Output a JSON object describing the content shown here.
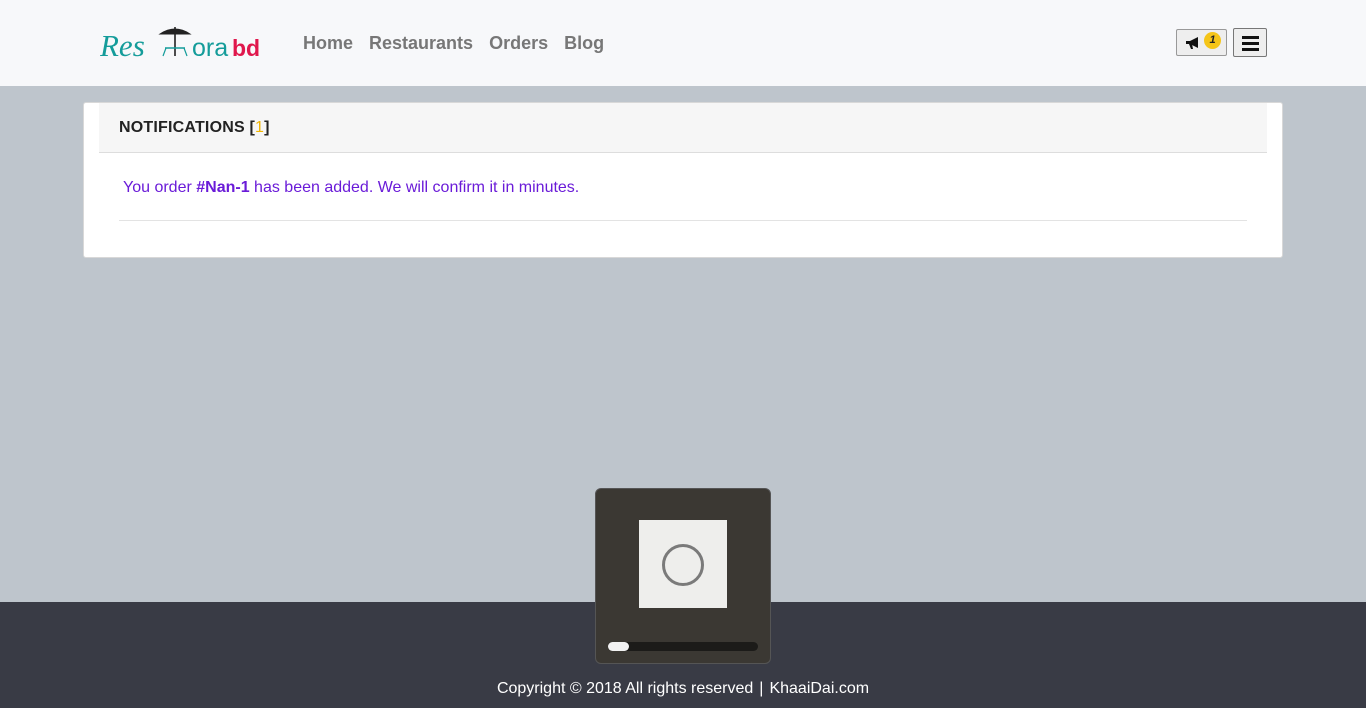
{
  "brand": {
    "logo_part1": "Res",
    "logo_part2": "ora",
    "logo_part3": "bd",
    "color_teal": "#149c9a",
    "color_pink": "#e0174c"
  },
  "nav": {
    "items": [
      {
        "label": "Home"
      },
      {
        "label": "Restaurants"
      },
      {
        "label": "Orders"
      },
      {
        "label": "Blog"
      }
    ]
  },
  "header": {
    "notification_icon": "megaphone-icon",
    "notification_count": "1",
    "menu_icon": "hamburger-menu-icon"
  },
  "notifications": {
    "title_prefix": "NOTIFICATIONS [",
    "count": "1",
    "title_suffix": "]",
    "items": [
      {
        "text_before": "You order ",
        "order_id": "#Nan-1",
        "text_after": " has been added. We will confirm it in minutes."
      }
    ]
  },
  "loader": {
    "icon": "loading-ring-icon",
    "progress_fraction": 0.14
  },
  "footer": {
    "copyright": "Copyright © 2018 All rights reserved",
    "separator": "|",
    "site": "KhaaiDai.com"
  }
}
